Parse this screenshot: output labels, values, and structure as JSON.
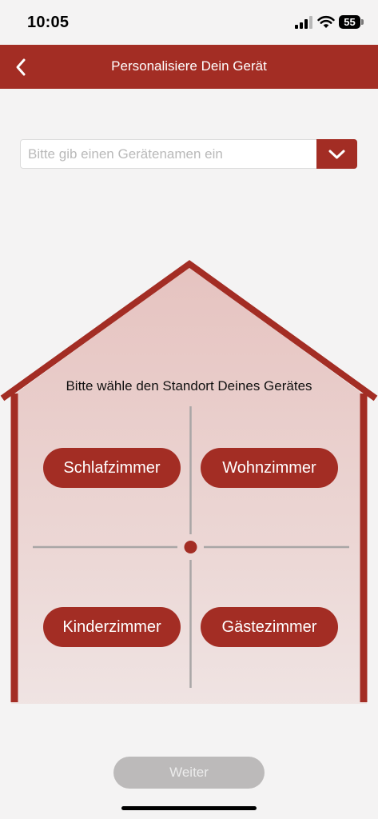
{
  "status_bar": {
    "time": "10:05",
    "battery": "55",
    "icons": [
      "signal-icon",
      "wifi-icon",
      "battery-icon"
    ]
  },
  "header": {
    "title": "Personalisiere Dein Gerät",
    "back_icon": "chevron-left-icon"
  },
  "device_name": {
    "value": "",
    "placeholder": "Bitte gib einen Gerätenamen ein",
    "dropdown_icon": "chevron-down-icon"
  },
  "location": {
    "prompt": "Bitte wähle den Standort Deines Gerätes",
    "rooms": [
      "Schlafzimmer",
      "Wohnzimmer",
      "Kinderzimmer",
      "Gästezimmer"
    ]
  },
  "continue_label": "Weiter",
  "colors": {
    "accent": "#a32d24",
    "background": "#f4f3f3",
    "disabled_button": "#bcbaba"
  }
}
